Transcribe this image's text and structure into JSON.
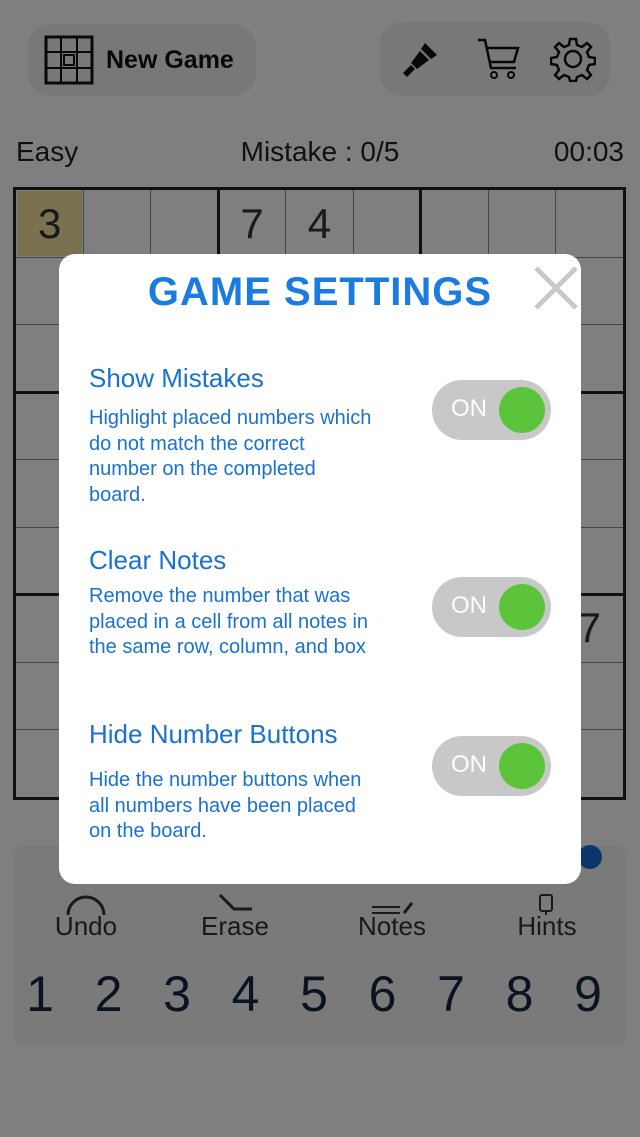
{
  "header": {
    "new_game_label": "New Game",
    "tools": [
      {
        "name": "theme-brush-icon"
      },
      {
        "name": "shop-cart-icon"
      },
      {
        "name": "settings-gear-icon"
      }
    ]
  },
  "status": {
    "difficulty": "Easy",
    "mistakes": "Mistake : 0/5",
    "timer": "00:03"
  },
  "board": {
    "visible_digits": [
      {
        "row": 0,
        "col": 0,
        "value": "3",
        "highlight": true
      },
      {
        "row": 0,
        "col": 3,
        "value": "7"
      },
      {
        "row": 0,
        "col": 4,
        "value": "4"
      },
      {
        "row": 6,
        "col": 8,
        "value": "7"
      }
    ],
    "highlight_color": "#f3e3a0"
  },
  "actions": {
    "undo": "Undo",
    "erase": "Erase",
    "notes": "Notes",
    "hints": "Hints"
  },
  "numbers": [
    "1",
    "2",
    "3",
    "4",
    "5",
    "6",
    "7",
    "8",
    "9"
  ],
  "dialog": {
    "title": "GAME SETTINGS",
    "close_icon": "close-x-icon",
    "options": [
      {
        "title": "Show Mistakes",
        "desc_lines": [
          "Highlight placed numbers which",
          "do not match the correct",
          "number on the completed",
          "board."
        ],
        "toggle_label": "ON"
      },
      {
        "title": "Clear Notes",
        "desc_lines": [
          "Remove the number that was",
          "placed in a cell from all notes in",
          "the same row, column, and box"
        ],
        "toggle_label": "ON"
      },
      {
        "title": "Hide Number Buttons",
        "desc_lines": [
          "Hide the number buttons when",
          "all numbers have been placed",
          "on the board."
        ],
        "toggle_label": "ON"
      }
    ]
  },
  "colors": {
    "accent_blue": "#1a72d0",
    "title_blue": "#1a7be0",
    "toggle_on_green": "#5cc43b",
    "toggle_track": "#c8c8c8",
    "overlay": "rgba(0,0,0,0.5)"
  }
}
